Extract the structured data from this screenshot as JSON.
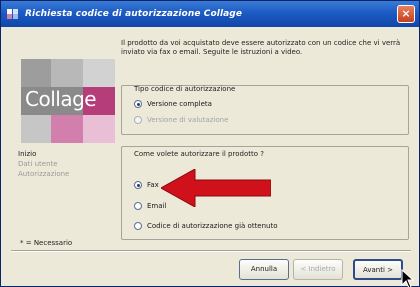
{
  "window": {
    "title": "Richiesta codice di autorizzazione Collage",
    "close_glyph": "×"
  },
  "logo": {
    "text": "Collage"
  },
  "intro_text": "Il prodotto da voi acquistato deve essere autorizzato con un codice che vi verrà inviato via fax o email. Seguite le istruzioni a video.",
  "steps": [
    {
      "label": "Inizio",
      "state": "current"
    },
    {
      "label": "Dati utente",
      "state": "disabled"
    },
    {
      "label": "Autorizzazione",
      "state": "disabled"
    }
  ],
  "required_note": "* = Necessario",
  "code_type_group": {
    "title": "Tipo codice di autorizzazione",
    "options": [
      {
        "label": "Versione completa",
        "selected": true,
        "enabled": true
      },
      {
        "label": "Versione di valutazione",
        "selected": false,
        "enabled": false
      }
    ]
  },
  "method_group": {
    "title": "Come volete autorizzare il prodotto ?",
    "options": [
      {
        "label": "Fax",
        "selected": true,
        "enabled": true
      },
      {
        "label": "Email",
        "selected": false,
        "enabled": true
      },
      {
        "label": "Codice di autorizzazione già ottenuto",
        "selected": false,
        "enabled": true
      }
    ]
  },
  "buttons": {
    "cancel": "Annulla",
    "back": "< Indietro",
    "next": "Avanti >"
  },
  "colors": {
    "title_bar": "#1c5bc4",
    "arrow": "#d0111b",
    "logo_tiles": [
      "#8e8e8e",
      "#a9a9a9",
      "#c4c4c4",
      "#b53d7a",
      "#d27fae",
      "#e9bfd6",
      "#7d7d7d"
    ]
  }
}
